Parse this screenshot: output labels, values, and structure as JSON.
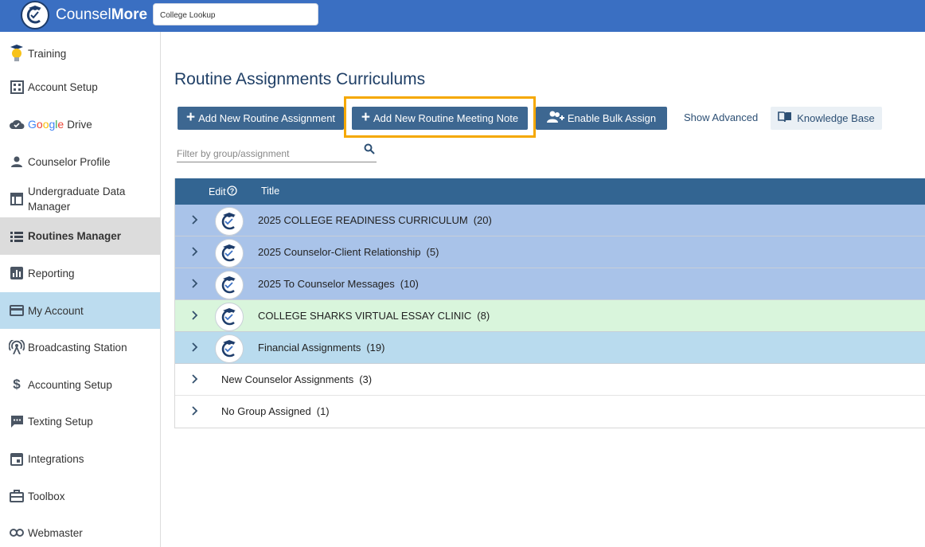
{
  "header": {
    "brand_light": "Counsel",
    "brand_bold": "More",
    "lookup_value": "College Lookup"
  },
  "sidebar": {
    "items": [
      {
        "label": "Training",
        "icon": "lightbulb-icon"
      },
      {
        "label": "Account Setup",
        "icon": "building-icon"
      },
      {
        "label": "Drive",
        "icon": "cloud-icon",
        "prefix": "Google"
      },
      {
        "label": "Counselor Profile",
        "icon": "person-icon"
      },
      {
        "label": "Undergraduate Data Manager",
        "icon": "table-icon"
      },
      {
        "label": "Routines Manager",
        "icon": "list-icon"
      },
      {
        "label": "Reporting",
        "icon": "chart-icon"
      },
      {
        "label": "My Account",
        "icon": "card-icon"
      },
      {
        "label": "Broadcasting Station",
        "icon": "broadcast-icon"
      },
      {
        "label": "Accounting Setup",
        "icon": "dollar-icon"
      },
      {
        "label": "Texting Setup",
        "icon": "chat-icon"
      },
      {
        "label": "Integrations",
        "icon": "calendar-icon"
      },
      {
        "label": "Toolbox",
        "icon": "toolbox-icon"
      },
      {
        "label": "Webmaster",
        "icon": "link-icon"
      }
    ]
  },
  "main": {
    "title": "Routine Assignments Curriculums",
    "buttons": {
      "add_assignment": "Add New Routine Assignment",
      "add_meeting_note": "Add New Routine Meeting Note",
      "bulk_assign": "Enable Bulk Assign",
      "show_advanced": "Show Advanced",
      "knowledge_base": "Knowledge Base"
    },
    "filter_placeholder": "Filter by group/assignment",
    "table": {
      "headers": {
        "edit": "Edit",
        "title": "Title"
      },
      "rows": [
        {
          "title": "2025 COLLEGE READINESS CURRICULUM",
          "count": "(20)",
          "color": "#a9c3e9"
        },
        {
          "title": "2025 Counselor-Client Relationship",
          "count": "(5)",
          "color": "#a9c3e9"
        },
        {
          "title": "2025 To Counselor Messages",
          "count": "(10)",
          "color": "#a9c3e9"
        },
        {
          "title": "COLLEGE SHARKS VIRTUAL ESSAY CLINIC",
          "count": "(8)",
          "color": "#d9f5dc"
        },
        {
          "title": "Financial Assignments",
          "count": "(19)",
          "color": "#b9dbee"
        },
        {
          "title": "New Counselor Assignments",
          "count": "(3)",
          "color": "#ffffff"
        },
        {
          "title": "No Group Assigned",
          "count": "(1)",
          "color": "#ffffff"
        }
      ]
    }
  },
  "colors": {
    "topbar": "#3a6fc2",
    "button": "#3d6791",
    "highlight": "#f5a800",
    "table_header": "#336592"
  }
}
